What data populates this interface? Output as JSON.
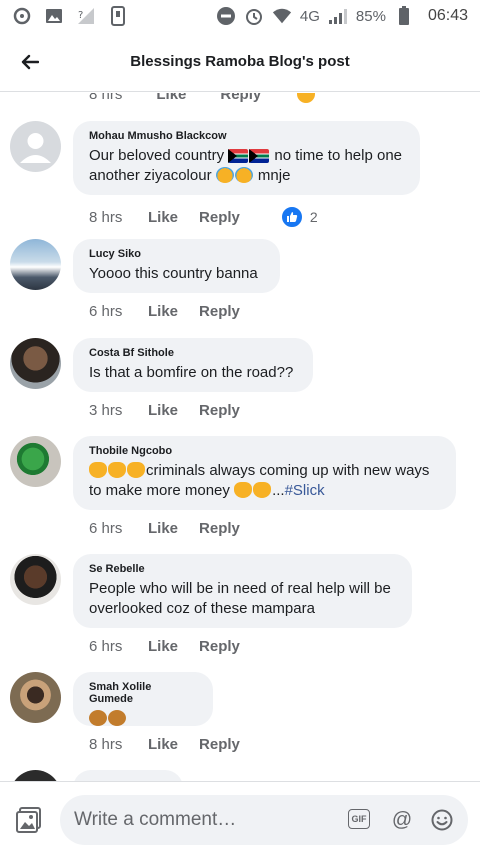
{
  "status_bar": {
    "network": "4G",
    "battery": "85%",
    "time": "06:43",
    "icons": [
      "notification-icon",
      "gallery-icon",
      "no-signal-icon",
      "phone-icon",
      "dnd-icon",
      "alarm-icon",
      "wifi-icon",
      "signal-icon",
      "battery-icon"
    ]
  },
  "header": {
    "title": "Blessings Ramoba Blog's post",
    "back_icon": "back-arrow-icon"
  },
  "partial_comment": {
    "time": "8 hrs",
    "like": "Like",
    "reply": "Reply"
  },
  "comments": [
    {
      "name": "Mohau Mmusho Blackcow",
      "text_a": "Our beloved country ",
      "text_b": " no time to help one another ziyacolour ",
      "text_c": " mnje",
      "time": "8 hrs",
      "like": "Like",
      "reply": "Reply",
      "reaction_count": "2",
      "avatar": "default-avatar"
    },
    {
      "name": "Lucy Siko",
      "text": "Yoooo this country banna",
      "time": "6 hrs",
      "like": "Like",
      "reply": "Reply",
      "avatar": "mountain-photo"
    },
    {
      "name": "Costa Bf Sithole",
      "text": "Is that a bomfire on the road??",
      "time": "3 hrs",
      "like": "Like",
      "reply": "Reply",
      "avatar": "man-photo"
    },
    {
      "name": "Thobile Ngcobo",
      "text_a": "criminals always coming up with new ways to make more money ",
      "text_b": "...",
      "link": "#Slick",
      "time": "6 hrs",
      "like": "Like",
      "reply": "Reply",
      "avatar": "parrot-photo"
    },
    {
      "name": "Se Rebelle",
      "text": "People who will be in need of real help will be overlooked coz of these mampara",
      "time": "6 hrs",
      "like": "Like",
      "reply": "Reply",
      "avatar": "man-photo"
    },
    {
      "name": "Smah Xolile Gumede",
      "text": "",
      "time": "8 hrs",
      "like": "Like",
      "reply": "Reply",
      "avatar": "woman-photo"
    }
  ],
  "composer": {
    "placeholder": "Write a comment…",
    "gif_label": "GIF",
    "at_label": "@"
  },
  "colors": {
    "link": "#385898",
    "like_blue": "#1877f2",
    "bubble": "#f0f2f5",
    "meta_gray": "#65676b"
  }
}
